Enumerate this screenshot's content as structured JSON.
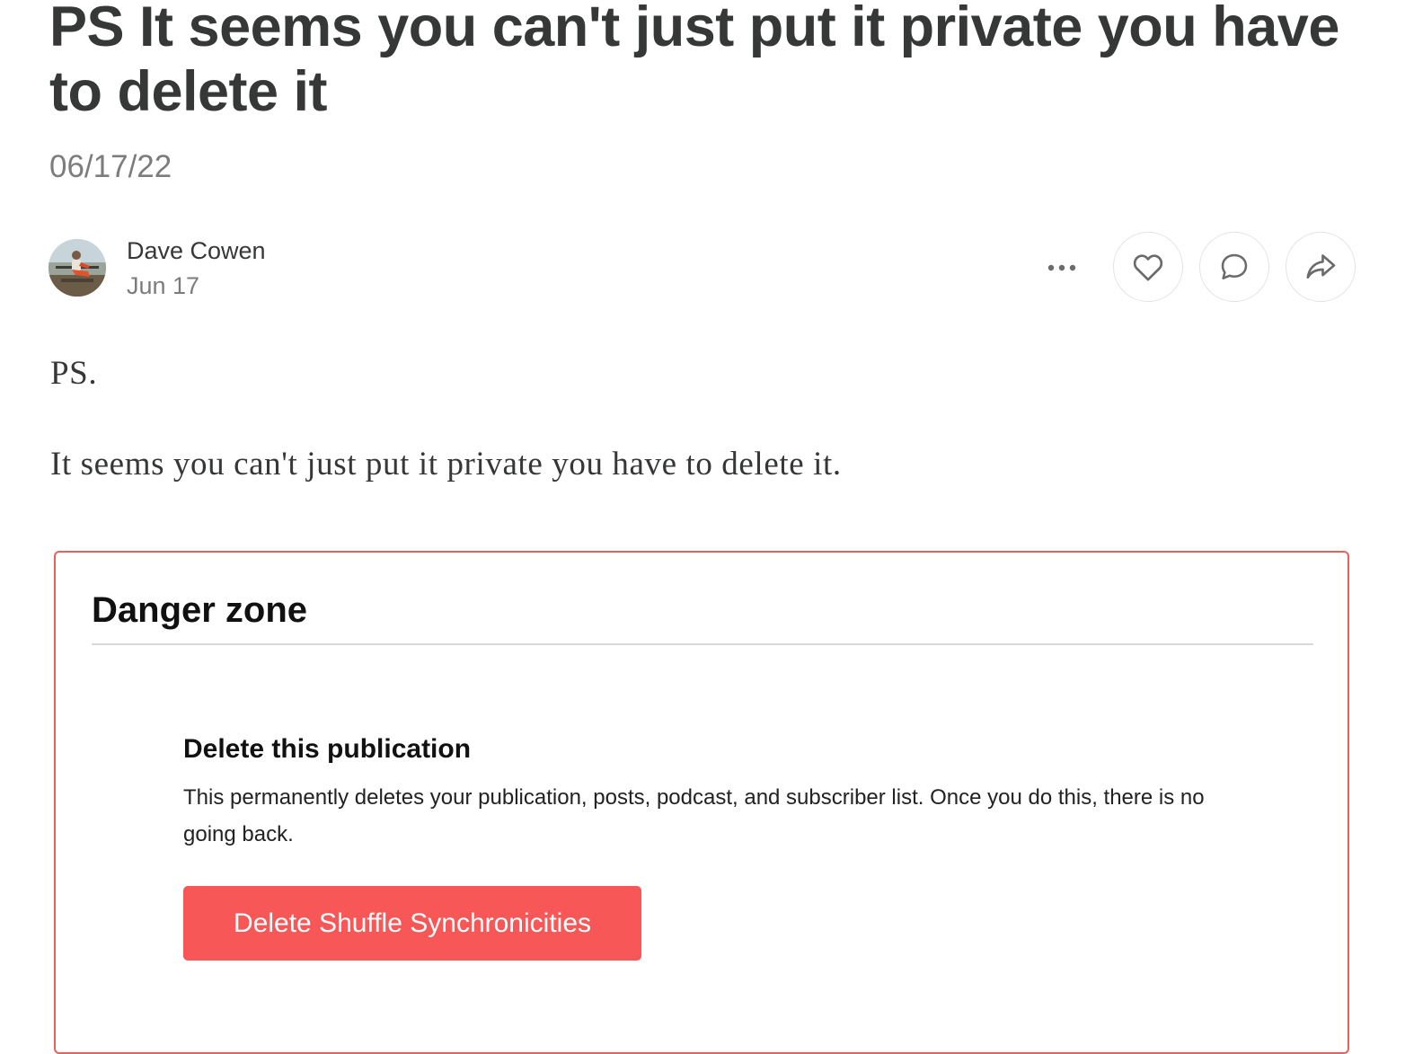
{
  "post": {
    "title": "PS It seems you can't just put it private you have to delete it",
    "date": "06/17/22"
  },
  "byline": {
    "author_name": "Dave Cowen",
    "author_date": "Jun 17",
    "avatar_icon": "avatar-photo"
  },
  "actions": {
    "more_icon": "more-horizontal-icon",
    "like_icon": "heart-icon",
    "comment_icon": "comment-bubble-icon",
    "share_icon": "share-arrow-icon"
  },
  "body": {
    "paragraphs": [
      "PS.",
      "It seems you can't just put it private you have to delete it."
    ]
  },
  "danger_zone": {
    "heading": "Danger zone",
    "section_title": "Delete this publication",
    "description": "This permanently deletes your publication, posts, podcast, and subscriber list. Once you do this, there is no going back.",
    "button_label": "Delete Shuffle Synchronicities"
  },
  "colors": {
    "title_text": "#363737",
    "muted_text": "#7c7c7c",
    "danger_border": "#e8615d",
    "danger_button": "#f75757"
  }
}
